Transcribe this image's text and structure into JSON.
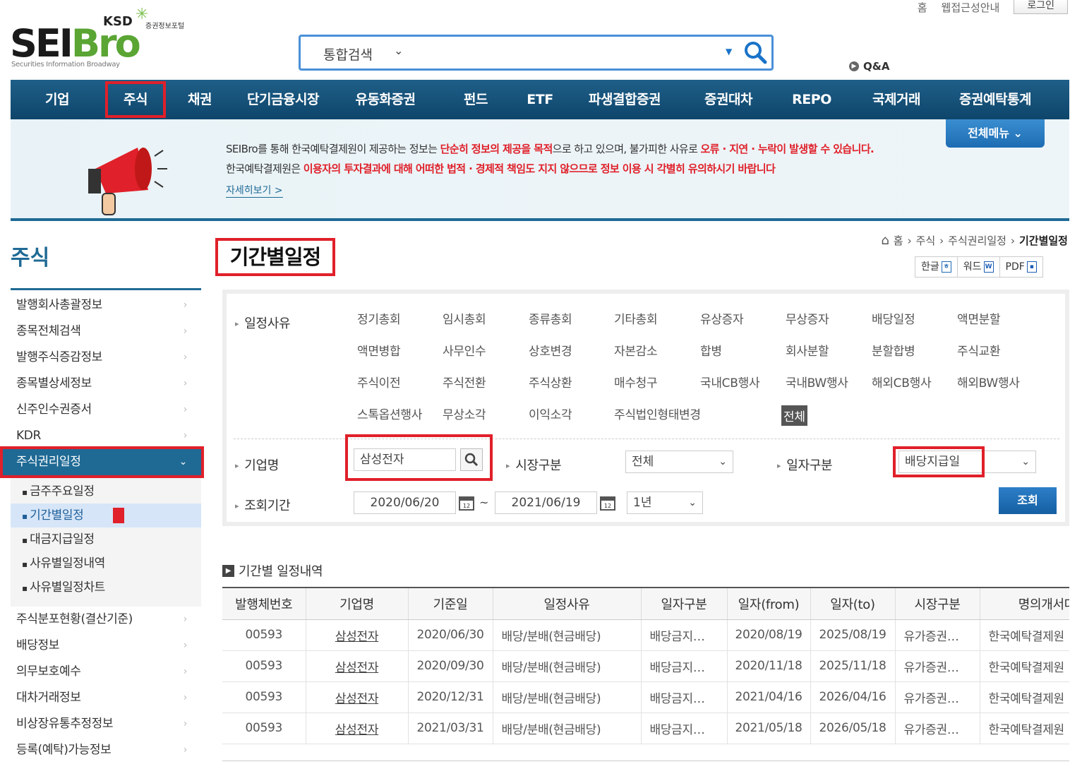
{
  "top": {
    "home": "홈",
    "accessibility": "웹접근성안내",
    "login": "로그인"
  },
  "logo": {
    "main_a": "SEI",
    "main_b": "Bro",
    "ksd": "KSD",
    "sub": "증권정보포털",
    "tagline": "Securities Information Broadway"
  },
  "search": {
    "type": "통합검색",
    "qa": "Q&A"
  },
  "nav": [
    "기업",
    "주식",
    "채권",
    "단기금융시장",
    "유동화증권",
    "펀드",
    "ETF",
    "파생결합증권",
    "증권대차",
    "REPO",
    "국제거래",
    "증권예탁통계"
  ],
  "banner": {
    "l1a": "SEIBro를 통해 한국예탁결제원이 제공하는 정보는 ",
    "l1b": "단순히 정보의 제공을 목적",
    "l1c": "으로 하고 있으며, 불가피한 사유로 ",
    "l1d": "오류 · 지연 · 누락이 발생할 수 있습니다.",
    "l2a": "한국예탁결제원은 ",
    "l2b": "이용자의 투자결과에 대해 어떠한 법적 · 경제적 책임도 지지 않으므로 정보 이용 시 각별히 유의하시기 바랍니다",
    "more": "자세히보기  >",
    "allmenu": "전체메뉴  ⌄"
  },
  "sidebar": {
    "title": "주식",
    "items_top": [
      "발행회사총괄정보",
      "종목전체검색",
      "발행주식증감정보",
      "종목별상세정보",
      "신주인수권증서",
      "KDR"
    ],
    "active": "주식권리일정",
    "sub": [
      "금주주요일정",
      "기간별일정",
      "대금지급일정",
      "사유별일정내역",
      "사유별일정차트"
    ],
    "items_bottom": [
      "주식분포현황(결산기준)",
      "배당정보",
      "의무보호예수",
      "대차거래정보",
      "비상장유통추정정보",
      "등록(예탁)가능정보"
    ]
  },
  "page": {
    "title": "기간별일정",
    "breadcrumb": [
      "홈",
      "주식",
      "주식권리일정",
      "기간별일정"
    ],
    "doc_buttons": [
      "한글",
      "워드",
      "PDF"
    ]
  },
  "filter": {
    "reason_label": "일정사유",
    "reasons": [
      [
        "정기총회",
        "임시총회",
        "종류총회",
        "기타총회",
        "유상증자",
        "무상증자",
        "배당일정",
        "액면분할"
      ],
      [
        "액면병합",
        "사무인수",
        "상호변경",
        "자본감소",
        "합병",
        "회사분할",
        "분할합병",
        "주식교환"
      ],
      [
        "주식이전",
        "주식전환",
        "주식상환",
        "매수청구",
        "국내CB행사",
        "국내BW행사",
        "해외CB행사",
        "해외BW행사"
      ],
      [
        "스톡옵션행사",
        "무상소각",
        "이익소각",
        "주식법인형태변경",
        "전체"
      ]
    ],
    "company_label": "기업명",
    "company_value": "삼성전자",
    "market_label": "시장구분",
    "market_value": "전체",
    "datetype_label": "일자구분",
    "datetype_value": "배당지급일",
    "period_label": "조회기간",
    "date_from": "2020/06/20",
    "tilde": "~",
    "date_to": "2021/06/19",
    "period_value": "1년",
    "query": "조회"
  },
  "results": {
    "title": "기간별 일정내역",
    "headers": [
      "발행체번호",
      "기업명",
      "기준일",
      "일정사유",
      "일자구분",
      "일자(from)",
      "일자(to)",
      "시장구분",
      "명의개서대리"
    ],
    "rows": [
      [
        "00593",
        "삼성전자",
        "2020/06/30",
        "배당/분배(현금배당)",
        "배당금지…",
        "2020/08/19",
        "2025/08/19",
        "유가증권…",
        "한국예탁결제원"
      ],
      [
        "00593",
        "삼성전자",
        "2020/09/30",
        "배당/분배(현금배당)",
        "배당금지…",
        "2020/11/18",
        "2025/11/18",
        "유가증권…",
        "한국예탁결제원"
      ],
      [
        "00593",
        "삼성전자",
        "2020/12/31",
        "배당/분배(현금배당)",
        "배당금지…",
        "2021/04/16",
        "2026/04/16",
        "유가증권…",
        "한국예탁결제원"
      ],
      [
        "00593",
        "삼성전자",
        "2021/03/31",
        "배당/분배(현금배당)",
        "배당금지…",
        "2021/05/18",
        "2026/05/18",
        "유가증권…",
        "한국예탁결제원"
      ]
    ]
  },
  "colors": {
    "nav": "#1f5f88",
    "accent_red": "#e0202a",
    "brand_green": "#5aa533",
    "sidebar_active": "#1f6a95"
  }
}
